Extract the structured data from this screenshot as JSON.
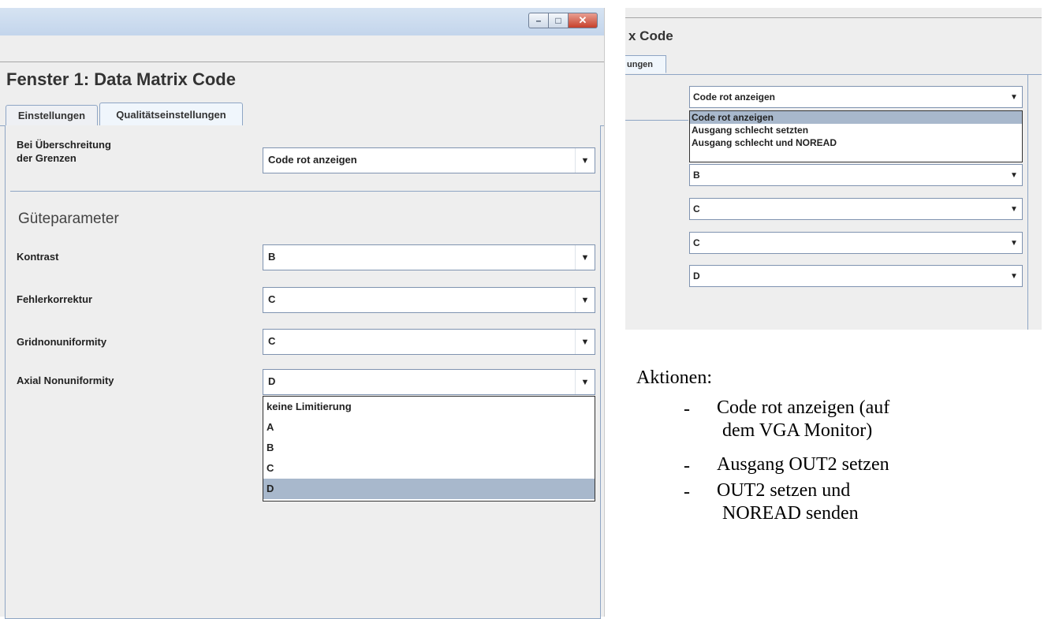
{
  "window": {
    "title": "Fenster 1: Data Matrix Code",
    "controls": {
      "minimize": "–",
      "maximize": "□",
      "close": "✕"
    }
  },
  "tabs": [
    {
      "label": "Einstellungen"
    },
    {
      "label": "Qualitätseinstellungen"
    }
  ],
  "settings": {
    "limit_label_line1": "Bei Überschreitung",
    "limit_label_line2": "der Grenzen",
    "limit_value": "Code rot anzeigen",
    "section_title": "Güteparameter",
    "params": [
      {
        "label": "Kontrast",
        "value": "B"
      },
      {
        "label": "Fehlerkorrektur",
        "value": "C"
      },
      {
        "label": "Gridnonuniformity",
        "value": "C"
      },
      {
        "label": "Axial Nonuniformity",
        "value": "D"
      }
    ]
  },
  "axial_dropdown": {
    "options": [
      "keine Limitierung",
      "A",
      "B",
      "C",
      "D"
    ],
    "selected": "D"
  },
  "crop": {
    "title": "x Code",
    "tab_label": "ungen",
    "limit_value": "Code rot anzeigen",
    "limit_options": [
      "Code rot anzeigen",
      "Ausgang schlecht setzten",
      "Ausgang schlecht und NOREAD"
    ],
    "selected": "Code rot anzeigen",
    "param_values": [
      "B",
      "C",
      "C",
      "D"
    ]
  },
  "notes": {
    "heading": "Aktionen:",
    "items": [
      {
        "line1": "Code rot anzeigen (auf",
        "line2": "dem VGA Monitor)"
      },
      {
        "line1": "Ausgang OUT2 setzen",
        "line2": ""
      },
      {
        "line1": "OUT2 setzen und",
        "line2": "NOREAD senden"
      }
    ],
    "bullet": "-"
  }
}
